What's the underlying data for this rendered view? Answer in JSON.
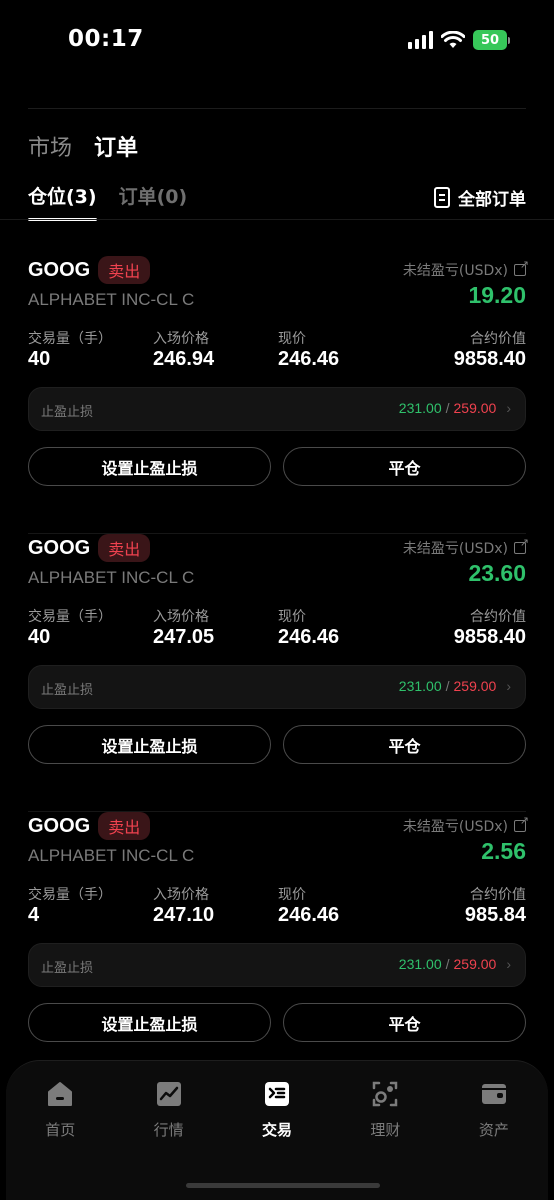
{
  "status_bar": {
    "time": "00:17",
    "battery": "50"
  },
  "top_tabs": [
    {
      "label": "市场",
      "active": false
    },
    {
      "label": "订单",
      "active": true
    }
  ],
  "sub_tabs": [
    {
      "label": "仓位(3)",
      "active": true
    },
    {
      "label": "订单(0)",
      "active": false
    }
  ],
  "all_orders_label": "全部订单",
  "positions": [
    {
      "symbol": "GOOG",
      "side": "卖出",
      "company": "ALPHABET INC-CL C",
      "pnl_label": "未结盈亏(USDx)",
      "pnl_value": "19.20",
      "qty_label": "交易量（手）",
      "qty": "40",
      "entry_label": "入场价格",
      "entry": "246.94",
      "current_label": "现价",
      "current": "246.46",
      "contract_label": "合约价值",
      "contract": "9858.40",
      "tpsl_label": "止盈止损",
      "tp": "231.00",
      "sl": "259.00",
      "set_tpsl_button": "设置止盈止损",
      "close_button": "平仓"
    },
    {
      "symbol": "GOOG",
      "side": "卖出",
      "company": "ALPHABET INC-CL C",
      "pnl_label": "未结盈亏(USDx)",
      "pnl_value": "23.60",
      "qty_label": "交易量（手）",
      "qty": "40",
      "entry_label": "入场价格",
      "entry": "247.05",
      "current_label": "现价",
      "current": "246.46",
      "contract_label": "合约价值",
      "contract": "9858.40",
      "tpsl_label": "止盈止损",
      "tp": "231.00",
      "sl": "259.00",
      "set_tpsl_button": "设置止盈止损",
      "close_button": "平仓"
    },
    {
      "symbol": "GOOG",
      "side": "卖出",
      "company": "ALPHABET INC-CL C",
      "pnl_label": "未结盈亏(USDx)",
      "pnl_value": "2.56",
      "qty_label": "交易量（手）",
      "qty": "4",
      "entry_label": "入场价格",
      "entry": "247.10",
      "current_label": "现价",
      "current": "246.46",
      "contract_label": "合约价值",
      "contract": "985.84",
      "tpsl_label": "止盈止损",
      "tp": "231.00",
      "sl": "259.00",
      "set_tpsl_button": "设置止盈止损",
      "close_button": "平仓"
    }
  ],
  "bottom_nav": [
    {
      "label": "首页",
      "icon": "home-icon",
      "active": false
    },
    {
      "label": "行情",
      "icon": "chart-icon",
      "active": false
    },
    {
      "label": "交易",
      "icon": "trade-icon",
      "active": true
    },
    {
      "label": "理财",
      "icon": "finance-icon",
      "active": false
    },
    {
      "label": "资产",
      "icon": "wallet-icon",
      "active": false
    }
  ],
  "colors": {
    "profit": "#2fc16b",
    "loss": "#f0424f",
    "background": "#000000"
  }
}
